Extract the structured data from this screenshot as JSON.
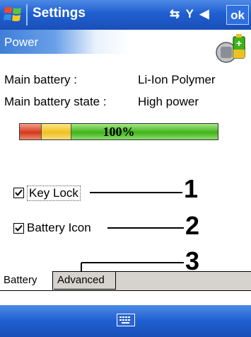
{
  "titlebar": {
    "title": "Settings",
    "status_icons": "↔x Yₓ ◂⹎",
    "ok_label": "ok"
  },
  "header": {
    "title": "Power"
  },
  "battery_info": {
    "main_battery_label": "Main battery :",
    "main_battery_value": "Li-Ion Polymer",
    "state_label": "Main battery state :",
    "state_value": "High power",
    "percent_text": "100%",
    "level_percent": 100
  },
  "options": {
    "key_lock_label": "Key Lock",
    "key_lock_checked": true,
    "battery_icon_label": "Battery Icon",
    "battery_icon_checked": true
  },
  "callouts": [
    "1",
    "2",
    "3"
  ],
  "tabs": [
    {
      "label": "Battery",
      "active": true
    },
    {
      "label": "Advanced",
      "active": false
    }
  ],
  "colors": {
    "titlebar": "#1f5fd0",
    "battery_green": "#3fb31a",
    "battery_yellow": "#efc020",
    "battery_red": "#d4391e"
  },
  "icons": {
    "start": "windows-flag-icon",
    "header": "battery-plug-icon",
    "input": "keyboard-icon"
  }
}
